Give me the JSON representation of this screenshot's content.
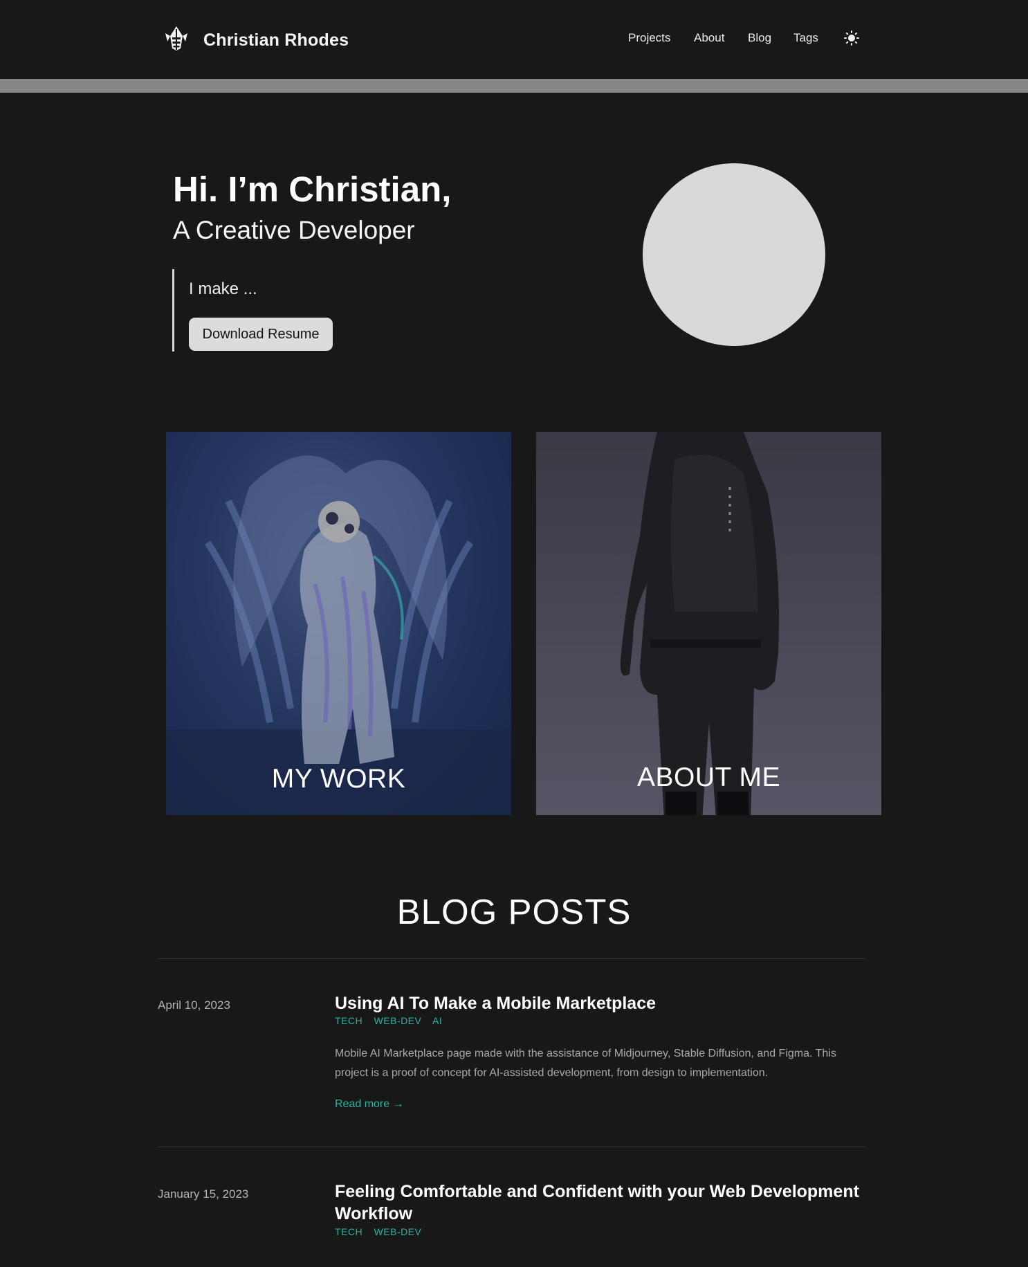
{
  "header": {
    "site_title": "Christian Rhodes",
    "nav": [
      "Projects",
      "About",
      "Blog",
      "Tags"
    ],
    "logo_icon": "bee-logo-icon",
    "theme_icon": "sun-icon"
  },
  "hero": {
    "greeting": "Hi. I’m Christian,",
    "subtitle": "A Creative Developer",
    "make_text": "I make ...",
    "resume_button": "Download Resume"
  },
  "cards": {
    "work_label": "MY WORK",
    "about_label": "ABOUT ME"
  },
  "blog": {
    "heading": "BLOG POSTS",
    "posts": [
      {
        "date": "April 10, 2023",
        "title": "Using AI To Make a Mobile Marketplace",
        "tags": [
          "TECH",
          "WEB-DEV",
          "AI"
        ],
        "summary": "Mobile AI Marketplace page made with the assistance of Midjourney, Stable Diffusion, and Figma. This project is a proof of concept for AI-assisted development, from design to implementation.",
        "read_more": "Read more →"
      },
      {
        "date": "January 15, 2023",
        "title": "Feeling Comfortable and Confident with your Web Development Workflow",
        "tags": [
          "TECH",
          "WEB-DEV"
        ]
      }
    ]
  },
  "colors": {
    "background": "#181818",
    "accent": "#2bb3a3",
    "divider_bar": "#878787"
  }
}
